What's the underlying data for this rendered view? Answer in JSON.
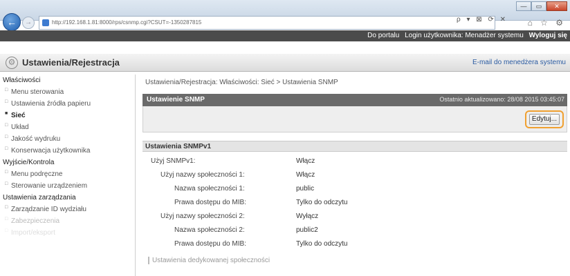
{
  "browser": {
    "url": "http://192.168.1.81:8000/rps/csnmp.cgi?CSUT=-1350287815",
    "address_tools": "ρ ▾ ⊠ ⟳ ✕",
    "right_icons": "⌂ ☆ ⚙"
  },
  "topbar": {
    "portal_link": "Do portalu",
    "login_label": "Login użytkownika: Menadżer systemu",
    "logout_link": "Wyloguj się"
  },
  "header": {
    "title": "Ustawienia/Rejestracja",
    "email_link": "E-mail do menedżera systemu"
  },
  "sidebar": {
    "sections": [
      {
        "label": "Właściwości",
        "items": [
          {
            "label": "Menu sterowania"
          },
          {
            "label": "Ustawienia źródła papieru"
          },
          {
            "label": "Sieć",
            "active": true
          },
          {
            "label": "Układ"
          },
          {
            "label": "Jakość wydruku"
          },
          {
            "label": "Konserwacja użytkownika"
          }
        ]
      },
      {
        "label": "Wyjście/Kontrola",
        "items": [
          {
            "label": "Menu podręczne"
          },
          {
            "label": "Sterowanie urządzeniem"
          }
        ]
      },
      {
        "label": "Ustawienia zarządzania",
        "items": [
          {
            "label": "Zarządzanie ID wydziału"
          },
          {
            "label": "Zabezpieczenia"
          },
          {
            "label": "Import/eksport"
          }
        ]
      }
    ]
  },
  "main": {
    "breadcrumb": "Ustawienia/Rejestracja: Właściwości: Sieć > Ustawienia SNMP",
    "panel_title": "Ustawienie SNMP",
    "last_updated": "Ostatnio aktualizowano: 28/08 2015 03:45:07",
    "edit_button": "Edytuj...",
    "section_title": "Ustawienia SNMPv1",
    "rows": [
      {
        "label": "Użyj SNMPv1:",
        "value": "Włącz",
        "level": 0
      },
      {
        "label": "Użyj nazwy społeczności 1:",
        "value": "Włącz",
        "level": 1
      },
      {
        "label": "Nazwa społeczności 1:",
        "value": "public",
        "level": 2
      },
      {
        "label": "Prawa dostępu do MIB:",
        "value": "Tylko do odczytu",
        "level": 2
      },
      {
        "label": "Użyj nazwy społeczności 2:",
        "value": "Wyłącz",
        "level": 1
      },
      {
        "label": "Nazwa społeczności 2:",
        "value": "public2",
        "level": 2
      },
      {
        "label": "Prawa dostępu do MIB:",
        "value": "Tylko do odczytu",
        "level": 2
      }
    ],
    "subsection_title": "Ustawienia dedykowanej społeczności"
  }
}
